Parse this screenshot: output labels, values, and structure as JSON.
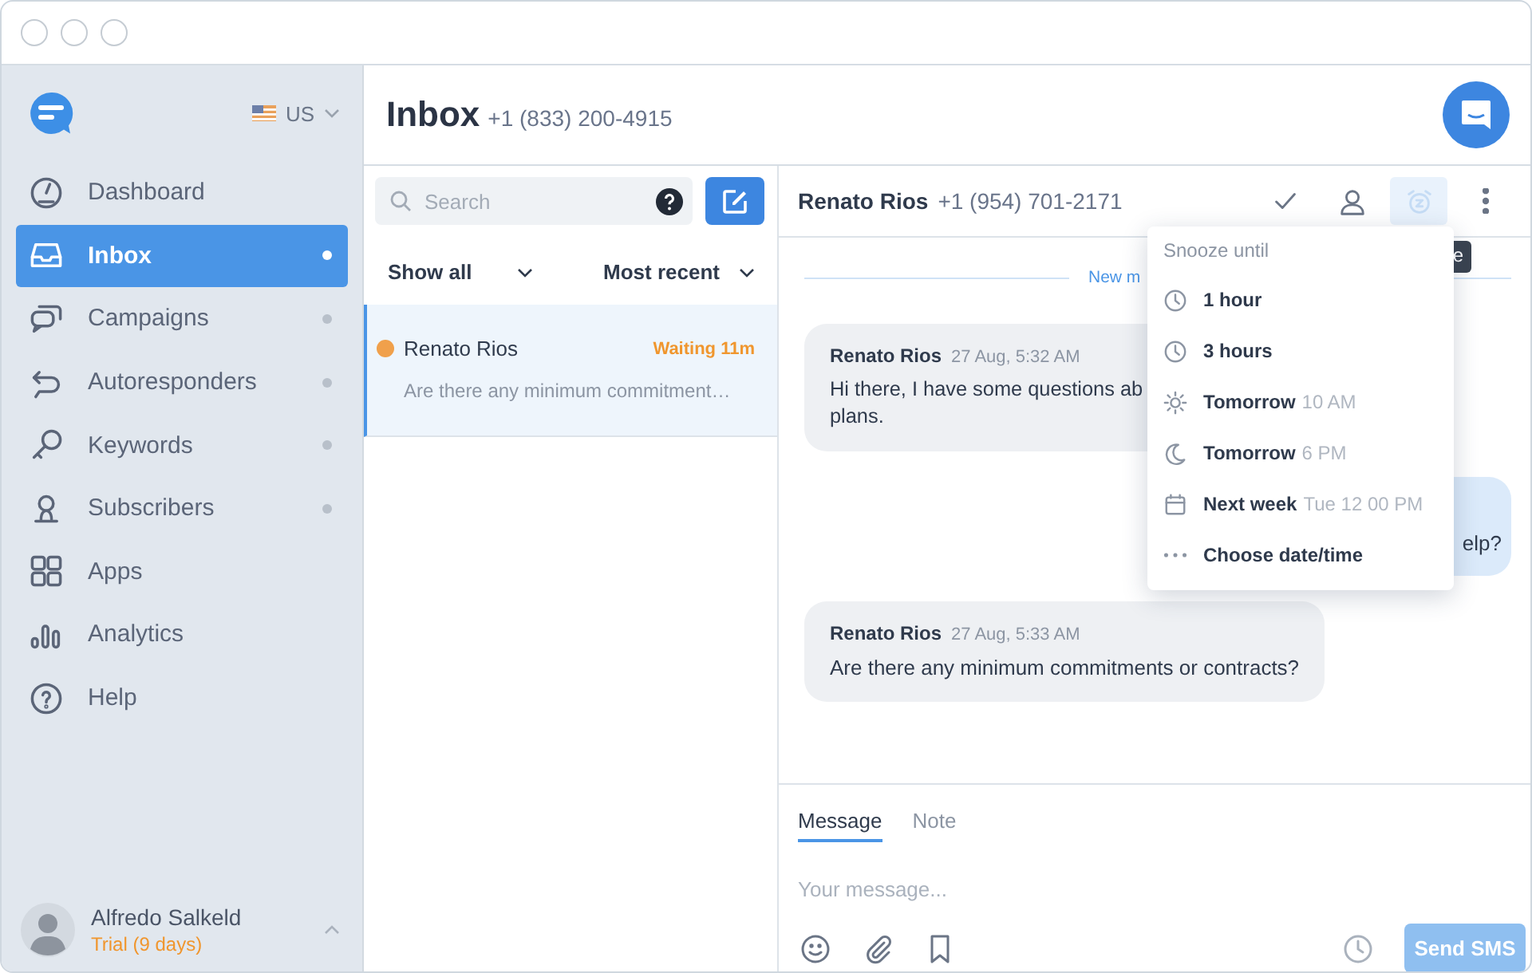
{
  "sidebar": {
    "country": "US",
    "nav": [
      {
        "label": "Dashboard",
        "selected": false,
        "dot": false
      },
      {
        "label": "Inbox",
        "selected": true,
        "dot": true
      },
      {
        "label": "Campaigns",
        "selected": false,
        "dot": true
      },
      {
        "label": "Autoresponders",
        "selected": false,
        "dot": true
      },
      {
        "label": "Keywords",
        "selected": false,
        "dot": true
      },
      {
        "label": "Subscribers",
        "selected": false,
        "dot": true
      },
      {
        "label": "Apps",
        "selected": false,
        "dot": false
      },
      {
        "label": "Analytics",
        "selected": false,
        "dot": false
      },
      {
        "label": "Help",
        "selected": false,
        "dot": false
      }
    ],
    "user": {
      "name": "Alfredo Salkeld",
      "plan": "Trial (9 days)"
    }
  },
  "header": {
    "title": "Inbox",
    "phone": "+1 (833) 200-4915"
  },
  "conversations": {
    "search": {
      "placeholder": "Search"
    },
    "filters": [
      {
        "label": "Show all"
      },
      {
        "label": "Most recent"
      }
    ],
    "items": [
      {
        "name": "Renato Rios",
        "status": "Waiting 11m",
        "preview": "Are there any minimum commitment…",
        "selected": true,
        "unread": true
      }
    ]
  },
  "chat": {
    "contact": "Renato Rios",
    "phone": "+1 (954) 701-2171",
    "snooze_active": true,
    "divider": "New m",
    "tooltip": "e",
    "messages": [
      {
        "kind": "received",
        "author": "Renato Rios",
        "time": "27 Aug, 5:32 AM",
        "lines": [
          "Hi there, I have some questions ab",
          "plans."
        ]
      },
      {
        "kind": "sent",
        "lines": [
          "elp?"
        ]
      },
      {
        "kind": "received",
        "author": "Renato Rios",
        "time": "27 Aug, 5:33 AM",
        "lines": [
          "Are there any minimum commitments or contracts?"
        ]
      }
    ],
    "composer": {
      "tabs": [
        {
          "label": "Message",
          "selected": true
        },
        {
          "label": "Note",
          "selected": false
        }
      ],
      "placeholder": "Your message...",
      "send": {
        "label": "Send SMS",
        "disabled": true
      }
    },
    "snooze_menu": {
      "title": "Snooze until",
      "items": [
        {
          "label": "1 hour"
        },
        {
          "label": "3 hours"
        },
        {
          "label": "Tomorrow",
          "detail": "10 AM"
        },
        {
          "label": "Tomorrow",
          "detail": "6 PM"
        },
        {
          "label": "Next week",
          "detail": "Tue 12 00 PM"
        },
        {
          "label": "Choose date/time"
        }
      ]
    }
  }
}
